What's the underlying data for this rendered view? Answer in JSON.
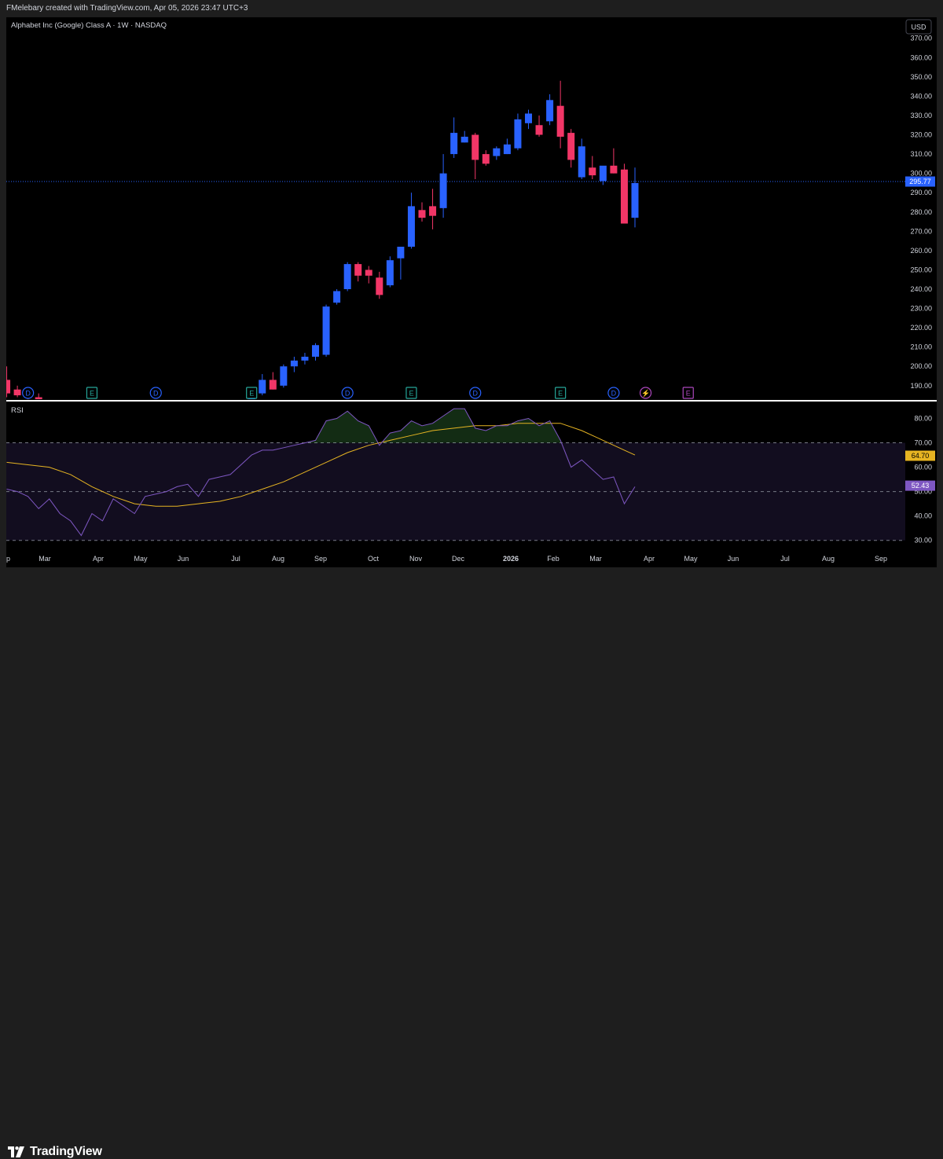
{
  "header": {
    "credit": "FMelebary created with TradingView.com, Apr 05, 2026 23:47 UTC+3"
  },
  "chart": {
    "title": "Alphabet Inc (Google) Class A · 1W · NASDAQ",
    "currency": "USD",
    "price_line": "295.77",
    "rsi_label": "RSI",
    "rsi_ma_value": "64.70",
    "rsi_value": "52.43"
  },
  "footer": {
    "brand": "TradingView"
  },
  "colors": {
    "up": "#2962ff",
    "down": "#f23667",
    "rsi": "#7e57c2",
    "rsi_ma": "#e6b422",
    "grid_text": "#d1d4dc"
  },
  "chart_data": [
    {
      "type": "candlestick",
      "title": "Alphabet Inc (Google) Class A · 1W · NASDAQ",
      "ylim": [
        183,
        376
      ],
      "y_ticks": [
        190,
        200,
        210,
        220,
        230,
        240,
        250,
        260,
        270,
        280,
        290,
        300,
        310,
        320,
        330,
        340,
        350,
        360,
        370
      ],
      "x_tick_labels": [
        "Mar",
        "Apr",
        "May",
        "Jun",
        "Jul",
        "Aug",
        "Sep",
        "Oct",
        "Nov",
        "Dec",
        "2026",
        "Feb",
        "Mar",
        "Apr",
        "May",
        "Jun",
        "Jul",
        "Aug",
        "Sep"
      ],
      "candles": [
        {
          "w": -1,
          "o": 193,
          "h": 200,
          "l": 184,
          "c": 186
        },
        {
          "w": 0,
          "o": 188,
          "h": 190,
          "l": 184,
          "c": 185
        },
        {
          "w": 1,
          "o": 186,
          "h": 188,
          "l": 183,
          "c": 184
        },
        {
          "w": 2,
          "o": 184,
          "h": 186,
          "l": 182,
          "c": 183
        },
        {
          "w": 22,
          "o": 182,
          "h": 187,
          "l": 181,
          "c": 185
        },
        {
          "w": 23,
          "o": 186,
          "h": 196,
          "l": 185,
          "c": 193
        },
        {
          "w": 24,
          "o": 193,
          "h": 197,
          "l": 188,
          "c": 188
        },
        {
          "w": 25,
          "o": 190,
          "h": 201,
          "l": 189,
          "c": 200
        },
        {
          "w": 26,
          "o": 200,
          "h": 205,
          "l": 197,
          "c": 203
        },
        {
          "w": 27,
          "o": 203,
          "h": 207,
          "l": 201,
          "c": 205
        },
        {
          "w": 28,
          "o": 205,
          "h": 212,
          "l": 203,
          "c": 211
        },
        {
          "w": 29,
          "o": 206,
          "h": 232,
          "l": 205,
          "c": 231
        },
        {
          "w": 30,
          "o": 233,
          "h": 240,
          "l": 232,
          "c": 239
        },
        {
          "w": 31,
          "o": 240,
          "h": 254,
          "l": 239,
          "c": 253
        },
        {
          "w": 32,
          "o": 253,
          "h": 254,
          "l": 244,
          "c": 247
        },
        {
          "w": 33,
          "o": 250,
          "h": 252,
          "l": 243,
          "c": 247
        },
        {
          "w": 34,
          "o": 246,
          "h": 249,
          "l": 235,
          "c": 237
        },
        {
          "w": 35,
          "o": 242,
          "h": 257,
          "l": 241,
          "c": 255
        },
        {
          "w": 36,
          "o": 256,
          "h": 262,
          "l": 245,
          "c": 262
        },
        {
          "w": 37,
          "o": 262,
          "h": 290,
          "l": 261,
          "c": 283
        },
        {
          "w": 38,
          "o": 281,
          "h": 285,
          "l": 275,
          "c": 277
        },
        {
          "w": 39,
          "o": 283,
          "h": 292,
          "l": 271,
          "c": 278
        },
        {
          "w": 40,
          "o": 282,
          "h": 310,
          "l": 277,
          "c": 300
        },
        {
          "w": 41,
          "o": 310,
          "h": 329,
          "l": 308,
          "c": 321
        },
        {
          "w": 42,
          "o": 316,
          "h": 322,
          "l": 316,
          "c": 319
        },
        {
          "w": 43,
          "o": 320,
          "h": 321,
          "l": 297,
          "c": 307
        },
        {
          "w": 44,
          "o": 310,
          "h": 312,
          "l": 304,
          "c": 305
        },
        {
          "w": 45,
          "o": 309,
          "h": 314,
          "l": 307,
          "c": 313
        },
        {
          "w": 46,
          "o": 310,
          "h": 318,
          "l": 310,
          "c": 315
        },
        {
          "w": 47,
          "o": 313,
          "h": 331,
          "l": 312,
          "c": 328
        },
        {
          "w": 48,
          "o": 326,
          "h": 333,
          "l": 323,
          "c": 331
        },
        {
          "w": 49,
          "o": 325,
          "h": 330,
          "l": 319,
          "c": 320
        },
        {
          "w": 50,
          "o": 327,
          "h": 341,
          "l": 325,
          "c": 338
        },
        {
          "w": 51,
          "o": 335,
          "h": 348,
          "l": 313,
          "c": 319
        },
        {
          "w": 52,
          "o": 321,
          "h": 323,
          "l": 303,
          "c": 307
        },
        {
          "w": 53,
          "o": 298,
          "h": 318,
          "l": 297,
          "c": 314
        },
        {
          "w": 54,
          "o": 303,
          "h": 309,
          "l": 297,
          "c": 299
        },
        {
          "w": 55,
          "o": 296,
          "h": 303,
          "l": 294,
          "c": 304
        },
        {
          "w": 56,
          "o": 304,
          "h": 313,
          "l": 300,
          "c": 300
        },
        {
          "w": 57,
          "o": 302,
          "h": 305,
          "l": 274,
          "c": 274
        },
        {
          "w": 58,
          "o": 277,
          "h": 303,
          "l": 272,
          "c": 295
        }
      ],
      "events": [
        {
          "w": 1,
          "k": "D"
        },
        {
          "w": 7,
          "k": "E"
        },
        {
          "w": 13,
          "k": "D"
        },
        {
          "w": 22,
          "k": "E"
        },
        {
          "w": 31,
          "k": "D"
        },
        {
          "w": 37,
          "k": "E"
        },
        {
          "w": 43,
          "k": "D"
        },
        {
          "w": 51,
          "k": "E"
        },
        {
          "w": 56,
          "k": "D"
        },
        {
          "w": 59,
          "k": "⚡"
        },
        {
          "w": 63,
          "k": "E"
        }
      ]
    },
    {
      "type": "line",
      "title": "RSI",
      "ylim": [
        27,
        85
      ],
      "y_ticks": [
        30,
        40,
        50,
        60,
        70,
        80
      ],
      "bands": [
        30,
        50,
        70
      ],
      "series": [
        {
          "name": "RSI",
          "values": [
            {
              "w": -1,
              "v": 51
            },
            {
              "w": 0,
              "v": 50
            },
            {
              "w": 1,
              "v": 48
            },
            {
              "w": 2,
              "v": 43
            },
            {
              "w": 3,
              "v": 47
            },
            {
              "w": 4,
              "v": 41
            },
            {
              "w": 5,
              "v": 38
            },
            {
              "w": 6,
              "v": 32
            },
            {
              "w": 7,
              "v": 41
            },
            {
              "w": 8,
              "v": 38
            },
            {
              "w": 9,
              "v": 47
            },
            {
              "w": 10,
              "v": 44
            },
            {
              "w": 11,
              "v": 41
            },
            {
              "w": 12,
              "v": 48
            },
            {
              "w": 13,
              "v": 49
            },
            {
              "w": 14,
              "v": 50
            },
            {
              "w": 15,
              "v": 52
            },
            {
              "w": 16,
              "v": 53
            },
            {
              "w": 17,
              "v": 48
            },
            {
              "w": 18,
              "v": 55
            },
            {
              "w": 19,
              "v": 56
            },
            {
              "w": 20,
              "v": 57
            },
            {
              "w": 21,
              "v": 61
            },
            {
              "w": 22,
              "v": 65
            },
            {
              "w": 23,
              "v": 67
            },
            {
              "w": 24,
              "v": 67
            },
            {
              "w": 25,
              "v": 68
            },
            {
              "w": 26,
              "v": 69
            },
            {
              "w": 27,
              "v": 70
            },
            {
              "w": 28,
              "v": 71
            },
            {
              "w": 29,
              "v": 79
            },
            {
              "w": 30,
              "v": 80
            },
            {
              "w": 31,
              "v": 83
            },
            {
              "w": 32,
              "v": 79
            },
            {
              "w": 33,
              "v": 77
            },
            {
              "w": 34,
              "v": 69
            },
            {
              "w": 35,
              "v": 74
            },
            {
              "w": 36,
              "v": 75
            },
            {
              "w": 37,
              "v": 79
            },
            {
              "w": 38,
              "v": 77
            },
            {
              "w": 39,
              "v": 78
            },
            {
              "w": 40,
              "v": 81
            },
            {
              "w": 41,
              "v": 84
            },
            {
              "w": 42,
              "v": 84
            },
            {
              "w": 43,
              "v": 76
            },
            {
              "w": 44,
              "v": 75
            },
            {
              "w": 45,
              "v": 77
            },
            {
              "w": 46,
              "v": 77
            },
            {
              "w": 47,
              "v": 79
            },
            {
              "w": 48,
              "v": 80
            },
            {
              "w": 49,
              "v": 77
            },
            {
              "w": 50,
              "v": 79
            },
            {
              "w": 51,
              "v": 71
            },
            {
              "w": 52,
              "v": 60
            },
            {
              "w": 53,
              "v": 63
            },
            {
              "w": 54,
              "v": 59
            },
            {
              "w": 55,
              "v": 55
            },
            {
              "w": 56,
              "v": 56
            },
            {
              "w": 57,
              "v": 45
            },
            {
              "w": 58,
              "v": 52
            }
          ]
        },
        {
          "name": "RSI-based MA",
          "values": [
            {
              "w": -1,
              "v": 62
            },
            {
              "w": 1,
              "v": 61
            },
            {
              "w": 3,
              "v": 60
            },
            {
              "w": 5,
              "v": 57
            },
            {
              "w": 7,
              "v": 52
            },
            {
              "w": 9,
              "v": 48
            },
            {
              "w": 11,
              "v": 45
            },
            {
              "w": 13,
              "v": 44
            },
            {
              "w": 15,
              "v": 44
            },
            {
              "w": 17,
              "v": 45
            },
            {
              "w": 19,
              "v": 46
            },
            {
              "w": 21,
              "v": 48
            },
            {
              "w": 23,
              "v": 51
            },
            {
              "w": 25,
              "v": 54
            },
            {
              "w": 27,
              "v": 58
            },
            {
              "w": 29,
              "v": 62
            },
            {
              "w": 31,
              "v": 66
            },
            {
              "w": 33,
              "v": 69
            },
            {
              "w": 35,
              "v": 71
            },
            {
              "w": 37,
              "v": 73
            },
            {
              "w": 39,
              "v": 75
            },
            {
              "w": 41,
              "v": 76
            },
            {
              "w": 43,
              "v": 77
            },
            {
              "w": 45,
              "v": 77
            },
            {
              "w": 47,
              "v": 78
            },
            {
              "w": 49,
              "v": 78
            },
            {
              "w": 51,
              "v": 78
            },
            {
              "w": 53,
              "v": 75
            },
            {
              "w": 55,
              "v": 71
            },
            {
              "w": 57,
              "v": 67
            },
            {
              "w": 58,
              "v": 65
            }
          ]
        }
      ]
    }
  ]
}
